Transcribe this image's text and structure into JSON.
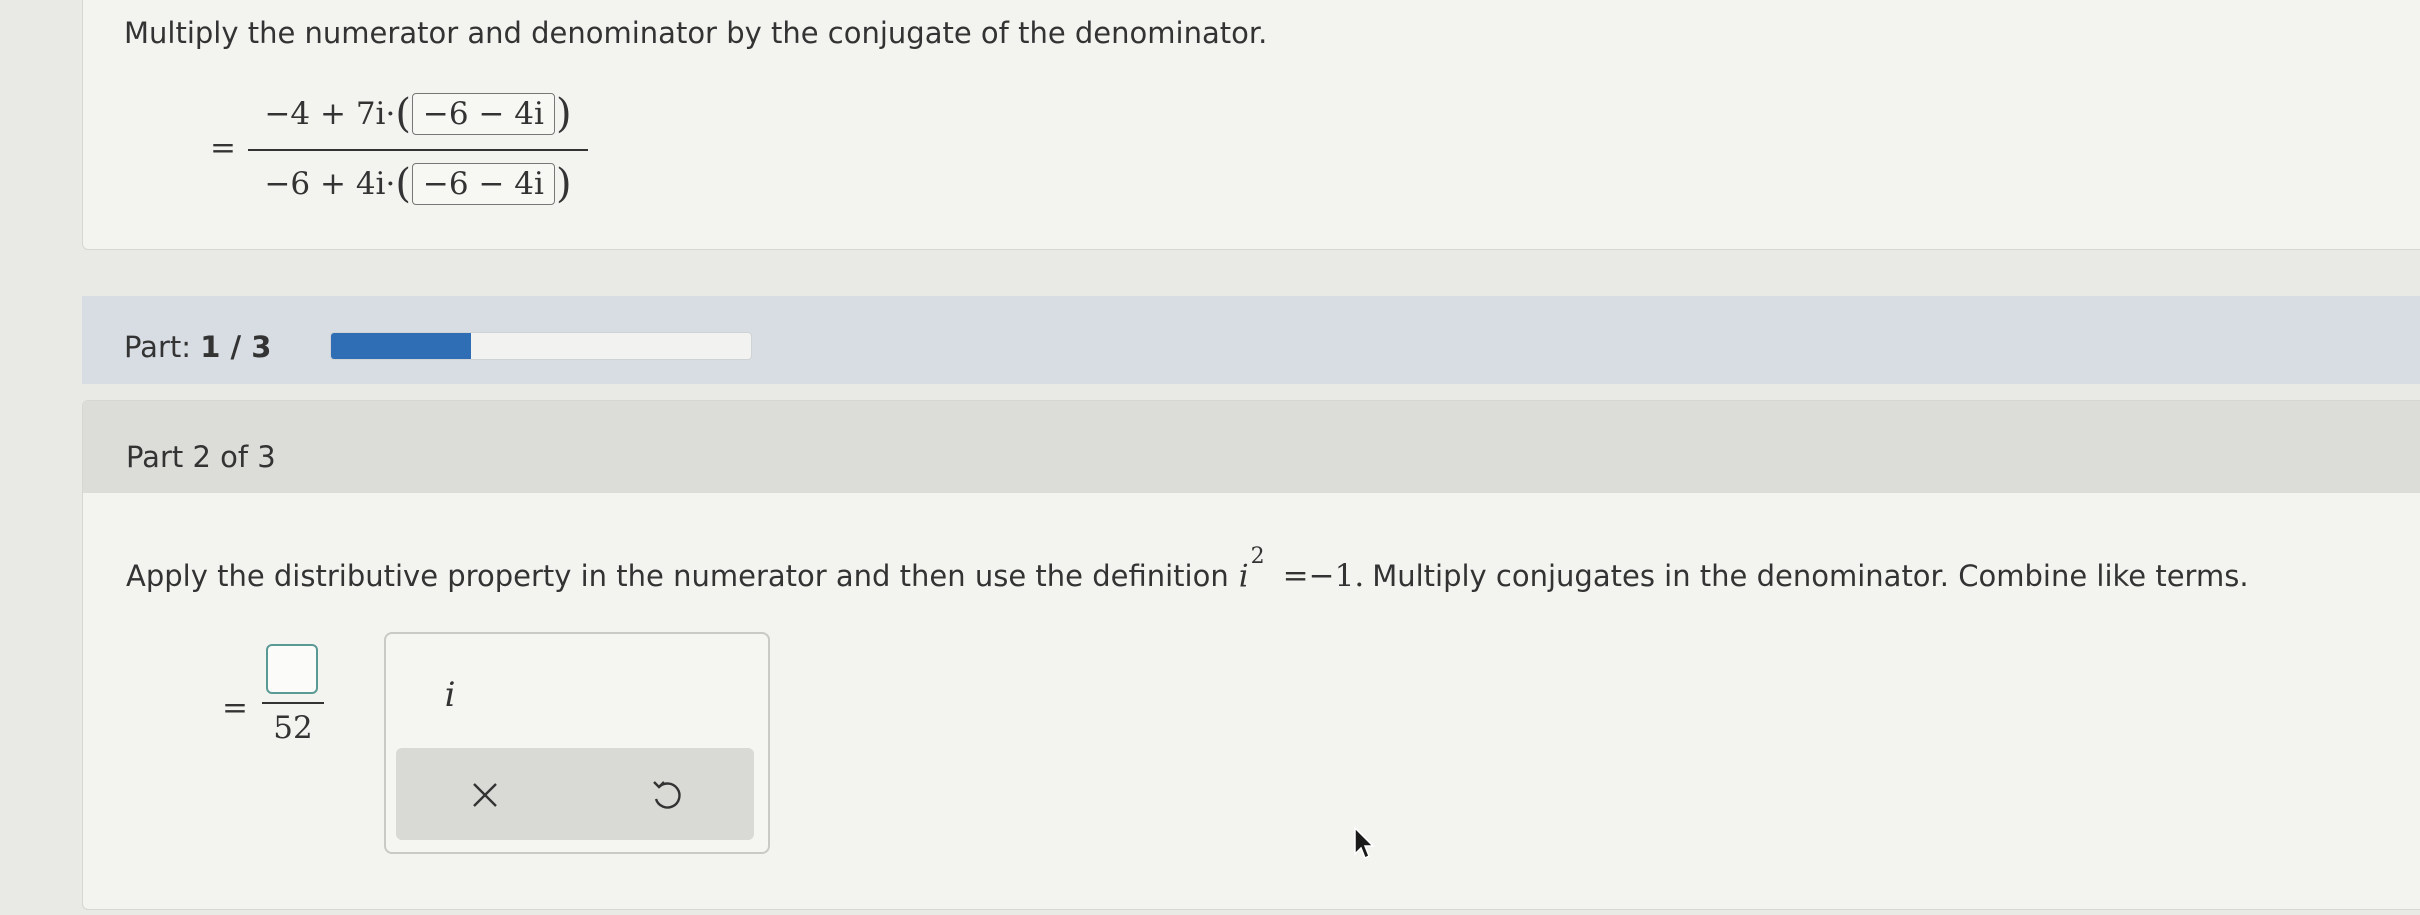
{
  "step1": {
    "instruction": "Multiply the numerator and denominator by the conjugate of the denominator.",
    "equals": "=",
    "numerator": {
      "expr": "−4 + 7i·",
      "conjugate": "−6 − 4i"
    },
    "denominator": {
      "expr": "−6 + 4i·",
      "conjugate": "−6 − 4i"
    }
  },
  "progress": {
    "label_prefix": "Part: ",
    "current_of_total": "1 / 3",
    "fraction_complete": 0.333
  },
  "part": {
    "title": "Part 2 of 3",
    "instruction_before": "Apply the distributive property in the numerator and then use the definition",
    "definition_base": "i",
    "definition_exp": "2",
    "definition_rest": "=−1.",
    "instruction_after": "Multiply conjugates in the denominator. Combine like terms."
  },
  "answer": {
    "equals": "=",
    "denominator": "52"
  },
  "palette": {
    "i_key": "i",
    "clear_symbol": "×",
    "undo_symbol": "↺"
  },
  "colors": {
    "progress_fill": "#2f6db5",
    "answer_box_border": "#5a9a94",
    "corner_badge": "#2f9a4a"
  }
}
